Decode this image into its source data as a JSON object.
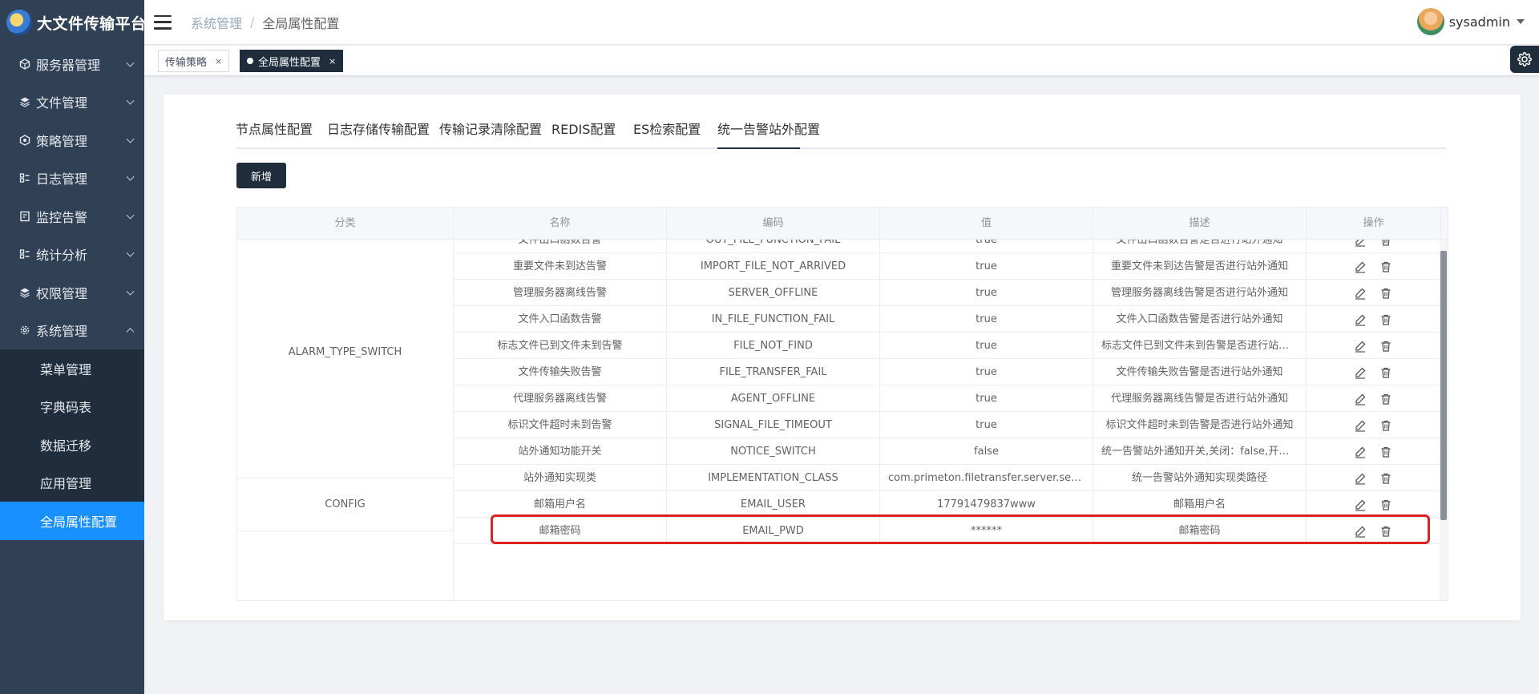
{
  "app": {
    "title": "大文件传输平台"
  },
  "sidebar": {
    "items": [
      {
        "label": "服务器管理",
        "icon": "server-icon"
      },
      {
        "label": "文件管理",
        "icon": "layers-icon"
      },
      {
        "label": "策略管理",
        "icon": "strategy-icon"
      },
      {
        "label": "日志管理",
        "icon": "log-icon"
      },
      {
        "label": "监控告警",
        "icon": "monitor-icon"
      },
      {
        "label": "统计分析",
        "icon": "chart-icon"
      },
      {
        "label": "权限管理",
        "icon": "shield-icon"
      },
      {
        "label": "系统管理",
        "icon": "gear-icon",
        "expanded": true
      }
    ],
    "sub_items": [
      "菜单管理",
      "字典码表",
      "数据迁移",
      "应用管理",
      "全局属性配置"
    ],
    "active_sub": "全局属性配置"
  },
  "header": {
    "breadcrumb": [
      "系统管理",
      "全局属性配置"
    ],
    "username": "sysadmin"
  },
  "tags": [
    {
      "label": "传输策略",
      "active": false
    },
    {
      "label": "全局属性配置",
      "active": true
    }
  ],
  "tabs": [
    "节点属性配置",
    "日志存储传输配置",
    "传输记录清除配置",
    "REDIS配置",
    "ES检索配置",
    "统一告警站外配置"
  ],
  "active_tab": "统一告警站外配置",
  "toolbar": {
    "add_label": "新增"
  },
  "table": {
    "columns": [
      "分类",
      "名称",
      "编码",
      "值",
      "描述",
      "操作"
    ],
    "categories": [
      "ALARM_TYPE_SWITCH",
      "CONFIG"
    ],
    "rows": [
      {
        "name": "文件出口函数告警",
        "code": "OUT_FILE_FUNCTION_FAIL",
        "value": "true",
        "desc": "文件出口函数告警是否进行站外通知"
      },
      {
        "name": "重要文件未到达告警",
        "code": "IMPORT_FILE_NOT_ARRIVED",
        "value": "true",
        "desc": "重要文件未到达告警是否进行站外通知"
      },
      {
        "name": "管理服务器离线告警",
        "code": "SERVER_OFFLINE",
        "value": "true",
        "desc": "管理服务器离线告警是否进行站外通知"
      },
      {
        "name": "文件入口函数告警",
        "code": "IN_FILE_FUNCTION_FAIL",
        "value": "true",
        "desc": "文件入口函数告警是否进行站外通知"
      },
      {
        "name": "标志文件已到文件未到告警",
        "code": "FILE_NOT_FIND",
        "value": "true",
        "desc": "标志文件已到文件未到告警是否进行站外通知"
      },
      {
        "name": "文件传输失败告警",
        "code": "FILE_TRANSFER_FAIL",
        "value": "true",
        "desc": "文件传输失败告警是否进行站外通知"
      },
      {
        "name": "代理服务器离线告警",
        "code": "AGENT_OFFLINE",
        "value": "true",
        "desc": "代理服务器离线告警是否进行站外通知"
      },
      {
        "name": "标识文件超时未到告警",
        "code": "SIGNAL_FILE_TIMEOUT",
        "value": "true",
        "desc": "标识文件超时未到告警是否进行站外通知"
      },
      {
        "name": "站外通知功能开关",
        "code": "NOTICE_SWITCH",
        "value": "false",
        "desc": "统一告警站外通知开关,关闭：false,开启：true"
      },
      {
        "name": "站外通知实现类",
        "code": "IMPLEMENTATION_CLASS",
        "value": "com.primeton.filetransfer.server.service.impl",
        "desc": "统一告警站外通知实现类路径"
      },
      {
        "name": "邮箱用户名",
        "code": "EMAIL_USER",
        "value": "17791479837www",
        "desc": "邮箱用户名"
      },
      {
        "name": "邮箱密码",
        "code": "EMAIL_PWD",
        "value": "******",
        "desc": "邮箱密码"
      }
    ]
  }
}
